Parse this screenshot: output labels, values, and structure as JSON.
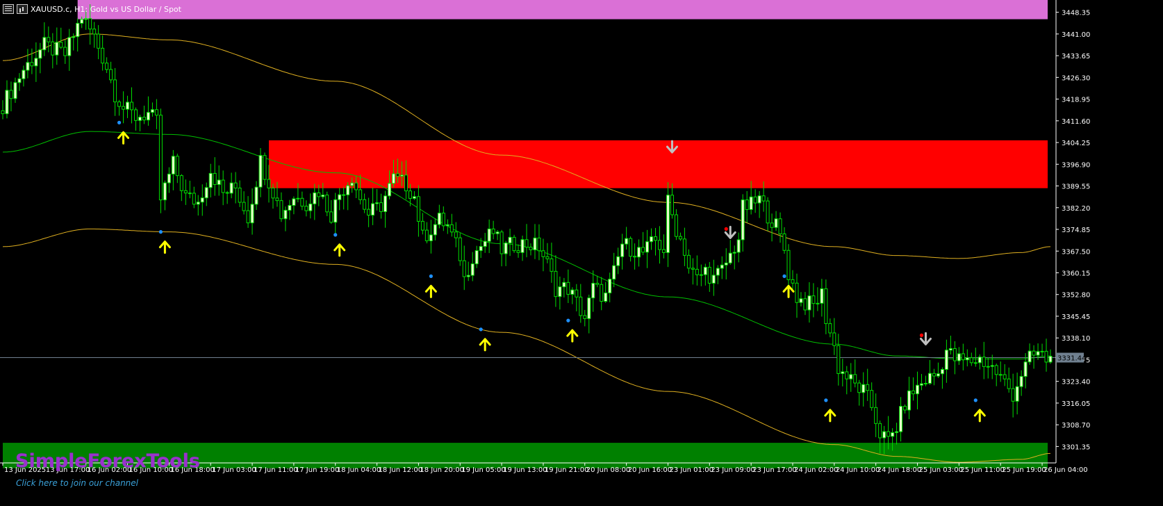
{
  "window": {
    "symbol_title": "XAUUSD.c, H1:  Gold vs US Dollar / Spot"
  },
  "branding": {
    "name": "SimpleForexTools",
    "link_text": "Click here to join our channel"
  },
  "current_price_label": "3331.44",
  "colors": {
    "background": "#000000",
    "candle_up_fill": "#eaffcc",
    "candle_outline": "#00e000",
    "mid_line": "#00c000",
    "band_line": "#e0b020",
    "resistance_zone": "#ff0000",
    "support_zone": "#008000",
    "top_zone": "#da70d6",
    "buy_arrow": "#ffff00",
    "sell_arrow": "#c0c0c0",
    "buy_dot": "#1e90ff",
    "sell_dot": "#ff0000",
    "axis_text": "#ffffff",
    "price_line": "#708090"
  },
  "icons": [
    "menu-icon",
    "chart-bars-icon"
  ],
  "chart_data": {
    "type": "candlestick",
    "title": "XAUUSD.c, H1:  Gold vs US Dollar / Spot",
    "ylim": [
      3296.5,
      3452.5
    ],
    "x_range": [
      0,
      252
    ],
    "y_ticks": [
      "3448.35",
      "3441.00",
      "3433.65",
      "3426.30",
      "3418.95",
      "3411.60",
      "3404.25",
      "3396.90",
      "3389.55",
      "3382.20",
      "3374.85",
      "3367.50",
      "3360.15",
      "3352.80",
      "3345.45",
      "3338.10",
      "3330.75",
      "3323.40",
      "3316.05",
      "3308.70",
      "3301.35"
    ],
    "x_labels": [
      {
        "label": "13 Jun 2025",
        "bar": 0
      },
      {
        "label": "13 Jun 17:00",
        "bar": 10
      },
      {
        "label": "16 Jun 02:00",
        "bar": 20
      },
      {
        "label": "16 Jun 10:00",
        "bar": 30
      },
      {
        "label": "16 Jun 18:00",
        "bar": 40
      },
      {
        "label": "17 Jun 03:00",
        "bar": 50
      },
      {
        "label": "17 Jun 11:00",
        "bar": 60
      },
      {
        "label": "17 Jun 19:00",
        "bar": 70
      },
      {
        "label": "18 Jun 04:00",
        "bar": 80
      },
      {
        "label": "18 Jun 12:00",
        "bar": 90
      },
      {
        "label": "18 Jun 20:00",
        "bar": 100
      },
      {
        "label": "19 Jun 05:00",
        "bar": 110
      },
      {
        "label": "19 Jun 13:00",
        "bar": 120
      },
      {
        "label": "19 Jun 21:00",
        "bar": 130
      },
      {
        "label": "20 Jun 08:00",
        "bar": 140
      },
      {
        "label": "20 Jun 16:00",
        "bar": 150
      },
      {
        "label": "23 Jun 01:00",
        "bar": 160
      },
      {
        "label": "23 Jun 09:00",
        "bar": 170
      },
      {
        "label": "23 Jun 17:00",
        "bar": 180
      },
      {
        "label": "24 Jun 02:00",
        "bar": 190
      },
      {
        "label": "24 Jun 10:00",
        "bar": 200
      },
      {
        "label": "24 Jun 18:00",
        "bar": 210
      },
      {
        "label": "25 Jun 03:00",
        "bar": 220
      },
      {
        "label": "25 Jun 11:00",
        "bar": 230
      },
      {
        "label": "25 Jun 19:00",
        "bar": 240
      },
      {
        "label": "26 Jun 04:00",
        "bar": 250
      }
    ],
    "close_path": [
      [
        0,
        3417
      ],
      [
        5,
        3429
      ],
      [
        10,
        3437
      ],
      [
        15,
        3434
      ],
      [
        19,
        3447
      ],
      [
        22,
        3440
      ],
      [
        25,
        3430
      ],
      [
        27,
        3421
      ],
      [
        29,
        3416
      ],
      [
        32,
        3413
      ],
      [
        35,
        3414
      ],
      [
        37,
        3411
      ],
      [
        38,
        3385
      ],
      [
        41,
        3397
      ],
      [
        44,
        3386
      ],
      [
        47,
        3384
      ],
      [
        50,
        3395
      ],
      [
        53,
        3387
      ],
      [
        56,
        3389
      ],
      [
        59,
        3379
      ],
      [
        62,
        3398
      ],
      [
        65,
        3388
      ],
      [
        67,
        3380
      ],
      [
        70,
        3386
      ],
      [
        73,
        3384
      ],
      [
        76,
        3388
      ],
      [
        79,
        3380
      ],
      [
        81,
        3387
      ],
      [
        84,
        3393
      ],
      [
        86,
        3385
      ],
      [
        88,
        3380
      ],
      [
        91,
        3383
      ],
      [
        94,
        3392
      ],
      [
        97,
        3390
      ],
      [
        99,
        3386
      ],
      [
        101,
        3372
      ],
      [
        103,
        3375
      ],
      [
        105,
        3378
      ],
      [
        107,
        3376
      ],
      [
        110,
        3366
      ],
      [
        111,
        3358
      ],
      [
        113,
        3366
      ],
      [
        116,
        3371
      ],
      [
        118,
        3374
      ],
      [
        120,
        3368
      ],
      [
        123,
        3370
      ],
      [
        126,
        3370
      ],
      [
        129,
        3369
      ],
      [
        131,
        3363
      ],
      [
        133,
        3355
      ],
      [
        136,
        3355
      ],
      [
        138,
        3350
      ],
      [
        140,
        3345
      ],
      [
        142,
        3355
      ],
      [
        145,
        3352
      ],
      [
        147,
        3360
      ],
      [
        149,
        3370
      ],
      [
        152,
        3368
      ],
      [
        154,
        3367
      ],
      [
        157,
        3371
      ],
      [
        159,
        3368
      ],
      [
        160,
        3384
      ],
      [
        162,
        3375
      ],
      [
        164,
        3368
      ],
      [
        165,
        3362
      ],
      [
        167,
        3358
      ],
      [
        169,
        3361
      ],
      [
        171,
        3358
      ],
      [
        173,
        3361
      ],
      [
        175,
        3366
      ],
      [
        177,
        3372
      ],
      [
        178,
        3382
      ],
      [
        180,
        3383
      ],
      [
        182,
        3385
      ],
      [
        184,
        3380
      ],
      [
        186,
        3376
      ],
      [
        188,
        3368
      ],
      [
        189,
        3360
      ],
      [
        191,
        3352
      ],
      [
        193,
        3350
      ],
      [
        195,
        3349
      ],
      [
        197,
        3353
      ],
      [
        198,
        3345
      ],
      [
        200,
        3335
      ],
      [
        201,
        3328
      ],
      [
        203,
        3325
      ],
      [
        205,
        3322
      ],
      [
        207,
        3320
      ],
      [
        209,
        3315
      ],
      [
        211,
        3306
      ],
      [
        213,
        3303
      ],
      [
        215,
        3308
      ],
      [
        217,
        3316
      ],
      [
        219,
        3320
      ],
      [
        222,
        3324
      ],
      [
        225,
        3326
      ],
      [
        227,
        3334
      ],
      [
        229,
        3331
      ],
      [
        232,
        3330
      ],
      [
        235,
        3331
      ],
      [
        238,
        3328
      ],
      [
        241,
        3323
      ],
      [
        243,
        3319
      ],
      [
        245,
        3326
      ],
      [
        247,
        3331
      ],
      [
        249,
        3333
      ],
      [
        251,
        3331
      ]
    ],
    "series": [
      {
        "name": "upper_band",
        "points": [
          [
            0,
            3432
          ],
          [
            21,
            3441
          ],
          [
            40,
            3439
          ],
          [
            80,
            3425
          ],
          [
            120,
            3400
          ],
          [
            160,
            3384
          ],
          [
            200,
            3369
          ],
          [
            215,
            3366
          ],
          [
            230,
            3365
          ],
          [
            245,
            3367
          ],
          [
            252,
            3369
          ]
        ]
      },
      {
        "name": "middle_band",
        "points": [
          [
            0,
            3401
          ],
          [
            21,
            3408
          ],
          [
            40,
            3407
          ],
          [
            80,
            3394
          ],
          [
            120,
            3370
          ],
          [
            160,
            3352
          ],
          [
            200,
            3336
          ],
          [
            215,
            3332
          ],
          [
            230,
            3331
          ],
          [
            245,
            3331
          ],
          [
            252,
            3332
          ]
        ]
      },
      {
        "name": "lower_band",
        "points": [
          [
            0,
            3369
          ],
          [
            21,
            3375
          ],
          [
            40,
            3374
          ],
          [
            80,
            3363
          ],
          [
            120,
            3340
          ],
          [
            160,
            3320
          ],
          [
            200,
            3302
          ],
          [
            215,
            3298
          ],
          [
            230,
            3296
          ],
          [
            245,
            3297
          ],
          [
            252,
            3299
          ]
        ]
      }
    ],
    "zones": [
      {
        "name": "top_zone",
        "y1": 3452.5,
        "y2": 3446.0,
        "x1": 18,
        "x2": 252
      },
      {
        "name": "resistance_zone",
        "y1": 3405.0,
        "y2": 3388.8,
        "x1": 64,
        "x2": 252
      },
      {
        "name": "support_zone",
        "y1": 3302.6,
        "y2": 3294.0,
        "x1": 0,
        "x2": 252
      }
    ],
    "price_line": 3331.44,
    "buy_arrows": [
      29,
      39,
      81,
      103,
      116,
      137,
      189,
      199,
      235
    ],
    "sell_arrows": [
      161,
      175,
      222
    ],
    "buy_dots": [
      [
        28,
        3411
      ],
      [
        38,
        3374
      ],
      [
        80,
        3373
      ],
      [
        103,
        3359
      ],
      [
        115,
        3341
      ],
      [
        136,
        3344
      ],
      [
        188,
        3359
      ],
      [
        198,
        3317
      ],
      [
        234,
        3317
      ]
    ],
    "sell_dots": [
      [
        160,
        3404
      ],
      [
        174,
        3375
      ],
      [
        221,
        3339
      ]
    ]
  }
}
